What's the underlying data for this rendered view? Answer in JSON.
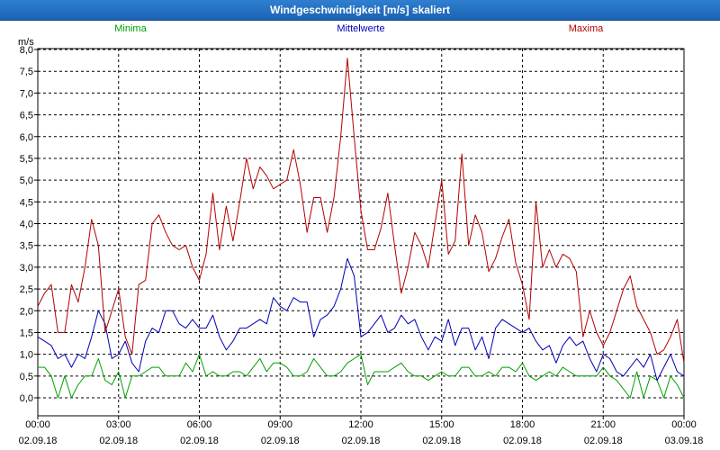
{
  "window": {
    "title": "Windgeschwindigkeit [m/s] skaliert"
  },
  "colors": {
    "minima": "#00a000",
    "mittelwerte": "#0000b4",
    "maxima": "#b40000",
    "grid": "#000000"
  },
  "chart_data": {
    "type": "line",
    "title": "Windgeschwindigkeit [m/s] skaliert",
    "ylabel": "m/s",
    "xlabel": "",
    "ylim": [
      0,
      8
    ],
    "grid": true,
    "legend": "top",
    "y_ticks": [
      "0,0",
      "0,5",
      "1,0",
      "1,5",
      "2,0",
      "2,5",
      "3,0",
      "3,5",
      "4,0",
      "4,5",
      "5,0",
      "5,5",
      "6,0",
      "6,5",
      "7,0",
      "7,5",
      "8,0"
    ],
    "x_ticks": [
      {
        "time": "00:00",
        "date": "02.09.18"
      },
      {
        "time": "03:00",
        "date": "02.09.18"
      },
      {
        "time": "06:00",
        "date": "02.09.18"
      },
      {
        "time": "09:00",
        "date": "02.09.18"
      },
      {
        "time": "12:00",
        "date": "02.09.18"
      },
      {
        "time": "15:00",
        "date": "02.09.18"
      },
      {
        "time": "18:00",
        "date": "02.09.18"
      },
      {
        "time": "21:00",
        "date": "02.09.18"
      },
      {
        "time": "00:00",
        "date": "03.09.18"
      }
    ],
    "x_hours": [
      0,
      0.25,
      0.5,
      0.75,
      1,
      1.25,
      1.5,
      1.75,
      2,
      2.25,
      2.5,
      2.75,
      3,
      3.25,
      3.5,
      3.75,
      4,
      4.25,
      4.5,
      4.75,
      5,
      5.25,
      5.5,
      5.75,
      6,
      6.25,
      6.5,
      6.75,
      7,
      7.25,
      7.5,
      7.75,
      8,
      8.25,
      8.5,
      8.75,
      9,
      9.25,
      9.5,
      9.75,
      10,
      10.25,
      10.5,
      10.75,
      11,
      11.25,
      11.5,
      11.75,
      12,
      12.25,
      12.5,
      12.75,
      13,
      13.25,
      13.5,
      13.75,
      14,
      14.25,
      14.5,
      14.75,
      15,
      15.25,
      15.5,
      15.75,
      16,
      16.25,
      16.5,
      16.75,
      17,
      17.25,
      17.5,
      17.75,
      18,
      18.25,
      18.5,
      18.75,
      19,
      19.25,
      19.5,
      19.75,
      20,
      20.25,
      20.5,
      20.75,
      21,
      21.25,
      21.5,
      21.75,
      22,
      22.25,
      22.5,
      22.75,
      23,
      23.25,
      23.5,
      23.75,
      24
    ],
    "series": [
      {
        "name": "Minima",
        "color": "#00a000",
        "values": [
          0.7,
          0.7,
          0.5,
          0.0,
          0.5,
          0.0,
          0.3,
          0.5,
          0.5,
          0.9,
          0.4,
          0.3,
          0.6,
          0.0,
          0.5,
          0.5,
          0.6,
          0.7,
          0.7,
          0.5,
          0.5,
          0.5,
          0.8,
          0.6,
          1.0,
          0.5,
          0.6,
          0.5,
          0.5,
          0.6,
          0.6,
          0.5,
          0.7,
          0.9,
          0.6,
          0.8,
          0.8,
          0.7,
          0.5,
          0.5,
          0.6,
          0.9,
          0.7,
          0.5,
          0.5,
          0.6,
          0.8,
          0.9,
          1.0,
          0.3,
          0.6,
          0.6,
          0.6,
          0.7,
          0.8,
          0.6,
          0.5,
          0.5,
          0.4,
          0.5,
          0.6,
          0.5,
          0.5,
          0.7,
          0.7,
          0.5,
          0.5,
          0.6,
          0.5,
          0.7,
          0.7,
          0.6,
          0.8,
          0.5,
          0.4,
          0.5,
          0.6,
          0.5,
          0.7,
          0.6,
          0.5,
          0.5,
          0.5,
          0.5,
          0.7,
          0.5,
          0.4,
          0.2,
          0.0,
          0.6,
          0.0,
          0.5,
          0.4,
          0.0,
          0.5,
          0.3,
          0.0
        ]
      },
      {
        "name": "Mittelwerte",
        "color": "#0000b4",
        "values": [
          1.4,
          1.3,
          1.2,
          0.9,
          1.0,
          0.7,
          1.0,
          0.9,
          1.4,
          2.0,
          1.7,
          0.9,
          1.0,
          1.3,
          0.8,
          0.6,
          1.3,
          1.6,
          1.5,
          2.0,
          2.0,
          1.7,
          1.6,
          1.8,
          1.6,
          1.6,
          1.9,
          1.4,
          1.1,
          1.3,
          1.6,
          1.6,
          1.7,
          1.8,
          1.7,
          2.3,
          2.1,
          2.0,
          2.3,
          2.2,
          2.2,
          1.4,
          1.8,
          1.9,
          2.1,
          2.5,
          3.2,
          2.8,
          1.4,
          1.5,
          1.7,
          1.9,
          1.5,
          1.6,
          1.9,
          1.7,
          1.8,
          1.4,
          1.1,
          1.4,
          1.3,
          1.8,
          1.2,
          1.6,
          1.6,
          1.1,
          1.4,
          0.9,
          1.6,
          1.8,
          1.7,
          1.6,
          1.5,
          1.6,
          1.3,
          1.1,
          1.2,
          0.8,
          1.2,
          1.4,
          1.2,
          1.3,
          0.9,
          0.6,
          1.0,
          0.9,
          0.6,
          0.5,
          0.7,
          0.9,
          0.7,
          1.0,
          0.4,
          0.7,
          1.0,
          0.6,
          0.5
        ]
      },
      {
        "name": "Maxima",
        "color": "#b40000",
        "values": [
          2.1,
          2.4,
          2.6,
          1.5,
          1.5,
          2.6,
          2.2,
          3.0,
          4.1,
          3.5,
          1.5,
          2.0,
          2.5,
          1.4,
          1.0,
          2.6,
          2.7,
          4.0,
          4.2,
          3.8,
          3.5,
          3.4,
          3.5,
          3.0,
          2.7,
          3.3,
          4.7,
          3.4,
          4.4,
          3.6,
          4.5,
          5.5,
          4.8,
          5.3,
          5.1,
          4.8,
          4.9,
          5.0,
          5.7,
          4.9,
          3.8,
          4.6,
          4.6,
          3.8,
          4.6,
          6.0,
          7.8,
          6.0,
          4.3,
          3.4,
          3.4,
          3.9,
          4.7,
          3.5,
          2.4,
          3.0,
          3.8,
          3.5,
          3.0,
          4.0,
          5.0,
          3.3,
          3.6,
          5.6,
          3.5,
          4.2,
          3.8,
          2.9,
          3.2,
          3.7,
          4.1,
          3.1,
          2.6,
          1.8,
          4.5,
          3.0,
          3.4,
          3.0,
          3.3,
          3.2,
          2.9,
          1.4,
          2.0,
          1.5,
          1.2,
          1.5,
          2.0,
          2.5,
          2.8,
          2.1,
          1.8,
          1.5,
          1.0,
          1.1,
          1.4,
          1.8,
          0.8
        ]
      }
    ]
  }
}
